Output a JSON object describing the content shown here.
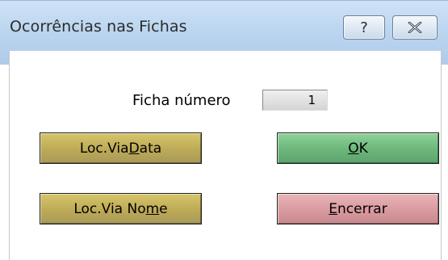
{
  "window": {
    "title": "Ocorrências nas Fichas",
    "help_glyph": "?",
    "close_icon": "close-icon"
  },
  "ficha": {
    "label": "Ficha número",
    "value": "1"
  },
  "buttons": {
    "loc_data": {
      "pre": "Loc.Via ",
      "accel": "D",
      "post": "ata",
      "color": "#bdaa57"
    },
    "ok": {
      "pre": "",
      "accel": "O",
      "post": "K",
      "color": "#6cb67a"
    },
    "loc_nome": {
      "pre": "Loc.Via No",
      "accel": "m",
      "post": "e",
      "color": "#bdaa57"
    },
    "encerrar": {
      "pre": "",
      "accel": "E",
      "post": "ncerrar",
      "color": "#d99a9f"
    }
  }
}
